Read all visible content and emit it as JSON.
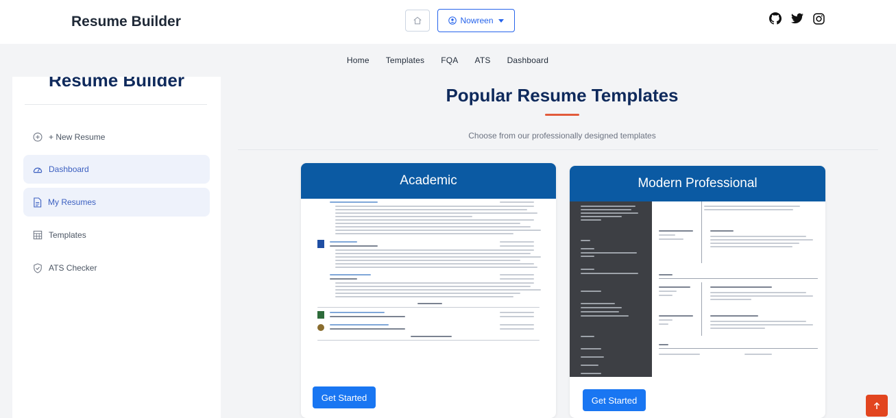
{
  "header": {
    "brand": "Resume Builder",
    "home_icon": "home-icon",
    "user_name": "Nowreen",
    "socials": [
      "github-icon",
      "twitter-icon",
      "instagram-icon"
    ]
  },
  "nav": {
    "items": [
      "Home",
      "Templates",
      "FQA",
      "ATS",
      "Dashboard"
    ]
  },
  "sidebar": {
    "title": "Resume Builder",
    "items": [
      {
        "label": "+ New Resume",
        "icon": "plus-circle-icon",
        "active": false
      },
      {
        "label": "Dashboard",
        "icon": "dashboard-icon",
        "active": true
      },
      {
        "label": "My Resumes",
        "icon": "file-icon",
        "active": true
      },
      {
        "label": "Templates",
        "icon": "grid-icon",
        "active": false
      },
      {
        "label": "ATS Checker",
        "icon": "shield-icon",
        "active": false
      }
    ]
  },
  "main": {
    "title": "Popular Resume Templates",
    "subtitle": "Choose from our professionally designed templates",
    "cards": [
      {
        "name": "Academic",
        "button": "Get Started"
      },
      {
        "name": "Modern Professional",
        "button": "Get Started"
      }
    ]
  },
  "colors": {
    "accent": "#0b5aa3",
    "button": "#1976f2",
    "title": "#0f2a5c",
    "underline": "#e25a3b",
    "scroll_top": "#e2451f"
  },
  "scroll_top_icon": "arrow-up-icon"
}
